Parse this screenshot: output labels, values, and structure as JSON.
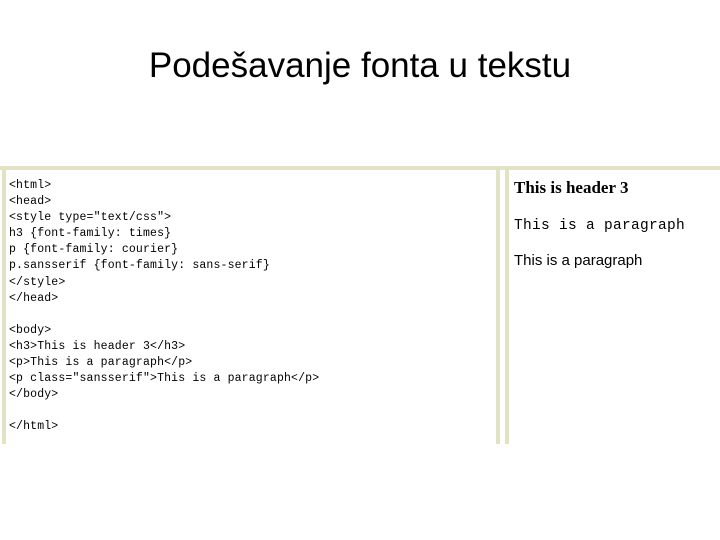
{
  "slide": {
    "title": "Podešavanje fonta u tekstu"
  },
  "code_pane": {
    "language": "html",
    "code": "<html>\n<head>\n<style type=\"text/css\">\nh3 {font-family: times}\np {font-family: courier}\np.sansserif {font-family: sans-serif}\n</style>\n</head>\n\n<body>\n<h3>This is header 3</h3>\n<p>This is a paragraph</p>\n<p class=\"sansserif\">This is a paragraph</p>\n</body>\n\n</html>",
    "lines": [
      "<html>",
      "<head>",
      "<style type=\"text/css\">",
      "h3 {font-family: times}",
      "p {font-family: courier}",
      "p.sansserif {font-family: sans-serif}",
      "</style>",
      "</head>",
      "",
      "<body>",
      "<h3>This is header 3</h3>",
      "<p>This is a paragraph</p>",
      "<p class=\"sansserif\">This is a paragraph</p>",
      "</body>",
      "",
      "</html>"
    ]
  },
  "render_pane": {
    "header3": "This is header 3",
    "paragraph_courier": "This is a paragraph",
    "paragraph_sansserif": "This is a paragraph"
  },
  "colors": {
    "background": "#ffffff",
    "text": "#000000",
    "frame_olive": "#e2e3c5"
  }
}
